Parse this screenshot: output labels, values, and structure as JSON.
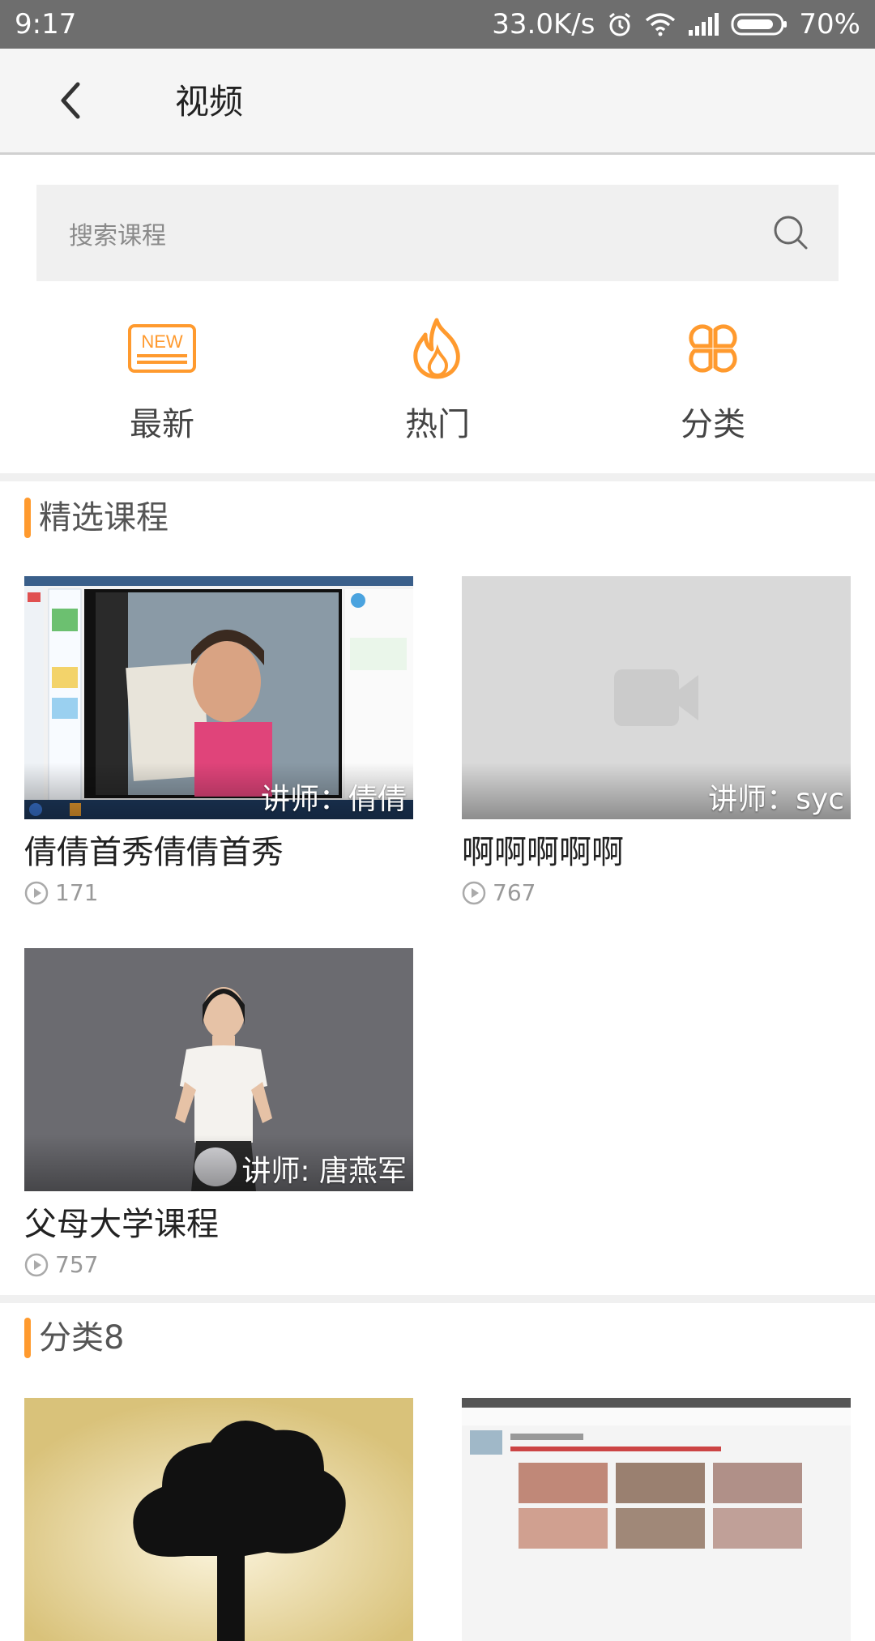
{
  "status_bar": {
    "time": "9:17",
    "network_speed": "33.0K/s",
    "battery": "70%",
    "icons": [
      "alarm-icon",
      "wifi-icon",
      "signal-icon",
      "battery-icon"
    ]
  },
  "header": {
    "title": "视频",
    "back_icon": "chevron-left-icon"
  },
  "search": {
    "placeholder": "搜索课程",
    "icon": "search-icon"
  },
  "shortcuts": [
    {
      "label": "最新",
      "icon": "new-badge-icon",
      "badge_text": "NEW"
    },
    {
      "label": "热门",
      "icon": "flame-icon"
    },
    {
      "label": "分类",
      "icon": "category-grid-icon"
    }
  ],
  "accent_color": "#ff9a2e",
  "sections": [
    {
      "title": "精选课程",
      "courses": [
        {
          "title": "倩倩首秀倩倩首秀",
          "lecturer": "讲师：倩倩",
          "plays": "171"
        },
        {
          "title": "啊啊啊啊啊",
          "lecturer": "讲师：syc",
          "plays": "767"
        },
        {
          "title": "父母大学课程",
          "lecturer": "讲师: 唐燕军",
          "plays": "757"
        }
      ]
    },
    {
      "title": "分类8",
      "courses": []
    }
  ]
}
